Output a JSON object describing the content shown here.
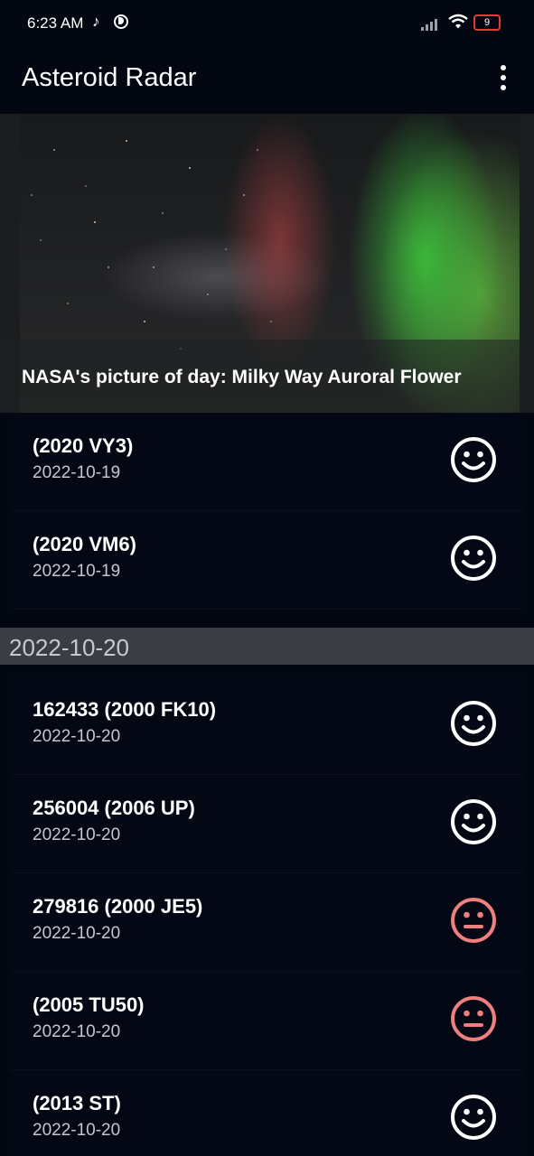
{
  "status_bar": {
    "time": "6:23 AM",
    "notification_glyph": "♪",
    "battery_level": "9",
    "icons": [
      "music-notification-icon",
      "data-saver-icon",
      "cellular-signal-icon",
      "wifi-icon",
      "battery-icon"
    ]
  },
  "toolbar": {
    "title": "Asteroid Radar",
    "menu_icon": "more-vert-icon"
  },
  "apod": {
    "caption": "NASA's picture of day: Milky Way Auroral Flower"
  },
  "colors": {
    "background": "#030712",
    "potentially_hazardous_icon": "#f07f7f",
    "safe_icon": "#ffffff",
    "section_header": "#3a3d44"
  },
  "asteroids_before_header": [
    {
      "name": "(2020 VY3)",
      "date": "2022-10-19",
      "status_icon": "happy-face-icon"
    },
    {
      "name": "(2020 VM6)",
      "date": "2022-10-19",
      "status_icon": "happy-face-icon"
    }
  ],
  "section_header": {
    "label": "2022-10-20"
  },
  "asteroids_after_header": [
    {
      "name": "162433 (2000 FK10)",
      "date": "2022-10-20",
      "status_icon": "happy-face-icon"
    },
    {
      "name": "256004 (2006 UP)",
      "date": "2022-10-20",
      "status_icon": "happy-face-icon"
    },
    {
      "name": "279816 (2000 JE5)",
      "date": "2022-10-20",
      "status_icon": "neutral-face-icon"
    },
    {
      "name": "(2005 TU50)",
      "date": "2022-10-20",
      "status_icon": "neutral-face-icon"
    },
    {
      "name": "(2013 ST)",
      "date": "2022-10-20",
      "status_icon": "happy-face-icon"
    }
  ]
}
